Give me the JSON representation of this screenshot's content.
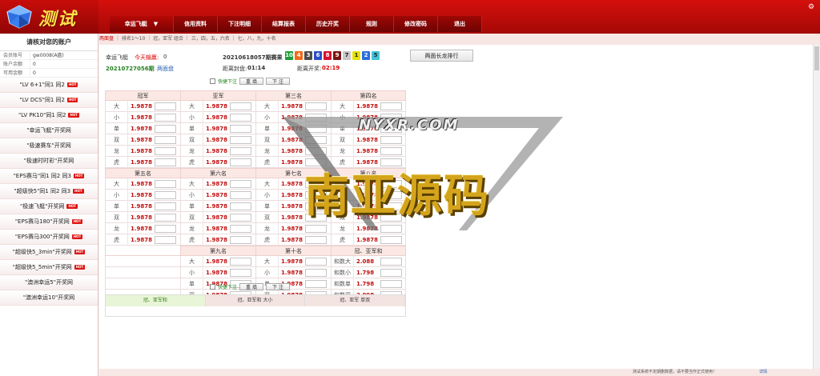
{
  "header": {
    "brand": "测试",
    "nav": [
      {
        "label": "幸运飞艇",
        "dropdown": "▼"
      },
      {
        "label": "信用资料"
      },
      {
        "label": "下注明细"
      },
      {
        "label": "结算报表"
      },
      {
        "label": "历史开奖"
      },
      {
        "label": "规则"
      },
      {
        "label": "修改密码"
      },
      {
        "label": "退出"
      }
    ]
  },
  "sidebar": {
    "title": "请核对您的账户",
    "account_rows": [
      {
        "k": "会员账号",
        "v": "gw0008(A盘)"
      },
      {
        "k": "账户余额",
        "v": "0"
      },
      {
        "k": "可用金额",
        "v": "0"
      }
    ],
    "links": [
      {
        "label": "\"LV 6+1\"同1 同2",
        "hot": "HOT"
      },
      {
        "label": "\"LV DCS\"同1 同2",
        "hot": "HOT"
      },
      {
        "label": "\"LV PK10\"同1 同2",
        "hot": "HOT"
      },
      {
        "label": "\"幸运飞艇\"开奖网",
        "hot": ""
      },
      {
        "label": "\"极速赛车\"开奖网",
        "hot": ""
      },
      {
        "label": "\"极速时时彩\"开奖网",
        "hot": ""
      },
      {
        "label": "\"EPS赛马\"同1 同2 同3",
        "hot": "HOT"
      },
      {
        "label": "\"超级快5\"同1 同2 同3",
        "hot": "HOT"
      },
      {
        "label": "\"极速飞艇\"开奖网",
        "hot": "HOT"
      },
      {
        "label": "\"EPS赛马180\"开奖网",
        "hot": "HOT"
      },
      {
        "label": "\"EPS赛马300\"开奖网",
        "hot": "HOT"
      },
      {
        "label": "\"超级快5_3min\"开奖网",
        "hot": "HOT"
      },
      {
        "label": "\"超级快5_5min\"开奖网",
        "hot": "HOT"
      },
      {
        "label": "\"澳洲幸运5\"开奖网",
        "hot": ""
      },
      {
        "label": "\"澳洲幸运10\"开奖网",
        "hot": ""
      }
    ]
  },
  "crumb": {
    "lead": "两面盘",
    "rest": "｜ 排名1～10 ｜ 冠，亚军 组合 ｜ 三，四，五，六名 ｜ 七，八，九，十名"
  },
  "info": {
    "game": "幸运飞艇",
    "win_label": "今天输赢:",
    "win_value": "0",
    "period": "20210618057期赛果",
    "draw_numbers": [
      "10",
      "4",
      "3",
      "6",
      "8",
      "9",
      "7",
      "1",
      "2",
      "5"
    ],
    "draw_colors": [
      "#1b9e3a",
      "#f26a1b",
      "#4d4d4d",
      "#2b4ec8",
      "#d7102f",
      "#7a1414",
      "#c9c9c9",
      "#e8e20a",
      "#2a6fde",
      "#43c3da"
    ],
    "rank_button": "两面长龙排行",
    "current_period": "20210727056期",
    "market": "两面盘",
    "close_label": "距离封盘:",
    "close_time": "01:14",
    "open_label": "距离开奖:",
    "open_time": "02:19"
  },
  "quickbet": {
    "label": "快捷下注",
    "reset": "重 填",
    "submit": "下 注"
  },
  "grid": {
    "block1_titles": [
      "冠军",
      "亚军",
      "第三名",
      "第四名"
    ],
    "block1_labels": [
      "大",
      "小",
      "单",
      "双",
      "龙",
      "虎"
    ],
    "block2_titles": [
      "第五名",
      "第六名",
      "第七名",
      "第八名"
    ],
    "block2_labels": [
      "大",
      "小",
      "单",
      "双",
      "龙",
      "虎"
    ],
    "block3_titles": [
      "",
      "第九名",
      "第十名",
      "冠、亚军和"
    ],
    "block3_labels": [
      "大",
      "小",
      "单",
      "双"
    ],
    "block3_sum_labels": [
      "和数大",
      "和数小",
      "和数单",
      "和数双"
    ],
    "block3_sum_odds": [
      "2.088",
      "1.798",
      "1.798",
      "2.098"
    ],
    "odd": "1.9878"
  },
  "low_tabs": [
    "冠、亚军和",
    "冠、亚军和 大小",
    "冠、亚军 单双"
  ],
  "watermark": {
    "url": "NYXR.COM",
    "text": "南亚源码"
  },
  "footer": {
    "text": "测试系统不定期删数据，请不要当作正式使用！",
    "link": "详情"
  }
}
